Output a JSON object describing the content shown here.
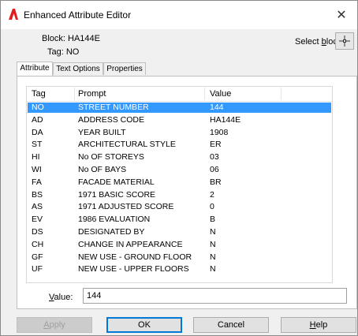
{
  "window": {
    "title": "Enhanced Attribute Editor",
    "close_symbol": "✕",
    "icon": "autocad-a-icon",
    "icon_color": "#e11d1d"
  },
  "info": {
    "block_line": "Block: HA144E",
    "tag_line": "Tag: NO"
  },
  "select_block": {
    "label_pre": "Select ",
    "label_u": "b",
    "label_post": "lock",
    "icon": "pick-crosshair-icon"
  },
  "tabs": [
    {
      "label": "Attribute",
      "active": true
    },
    {
      "label": "Text Options",
      "active": false
    },
    {
      "label": "Properties",
      "active": false
    }
  ],
  "table": {
    "columns": [
      "Tag",
      "Prompt",
      "Value"
    ],
    "rows": [
      {
        "tag": "NO",
        "prompt": "STREET NUMBER",
        "value": "144",
        "selected": true
      },
      {
        "tag": "AD",
        "prompt": "ADDRESS CODE",
        "value": "HA144E"
      },
      {
        "tag": "DA",
        "prompt": "YEAR BUILT",
        "value": "1908"
      },
      {
        "tag": "ST",
        "prompt": "ARCHITECTURAL STYLE",
        "value": "ER"
      },
      {
        "tag": "HI",
        "prompt": "No OF STOREYS",
        "value": "03"
      },
      {
        "tag": "WI",
        "prompt": "No OF BAYS",
        "value": "06"
      },
      {
        "tag": "FA",
        "prompt": "FACADE MATERIAL",
        "value": "BR"
      },
      {
        "tag": "BS",
        "prompt": "1971 BASIC SCORE",
        "value": "2"
      },
      {
        "tag": "AS",
        "prompt": "1971 ADJUSTED SCORE",
        "value": "0"
      },
      {
        "tag": "EV",
        "prompt": "1986 EVALUATION",
        "value": "B"
      },
      {
        "tag": "DS",
        "prompt": "DESIGNATED BY",
        "value": "N"
      },
      {
        "tag": "CH",
        "prompt": "CHANGE IN APPEARANCE",
        "value": "N"
      },
      {
        "tag": "GF",
        "prompt": "NEW USE - GROUND FLOOR",
        "value": "N"
      },
      {
        "tag": "UF",
        "prompt": "NEW USE - UPPER FLOORS",
        "value": "N"
      }
    ]
  },
  "value_field": {
    "label_u": "V",
    "label_post": "alue:",
    "value": "144"
  },
  "buttons": {
    "apply": {
      "label_u": "A",
      "label_post": "pply",
      "enabled": false
    },
    "ok": {
      "label": "OK"
    },
    "cancel": {
      "label": "Cancel"
    },
    "help": {
      "label_u": "H",
      "label_post": "elp"
    }
  },
  "colors": {
    "selection": "#3399ff",
    "accent": "#0078d7"
  }
}
